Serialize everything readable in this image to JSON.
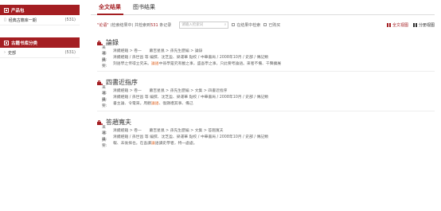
{
  "sidebar": {
    "sections": [
      {
        "header": "产品包",
        "items": [
          {
            "label": "经典古籍库一期",
            "count": "(531)"
          }
        ]
      },
      {
        "header": "古籍书库分类",
        "items": [
          {
            "label": "史部",
            "count": "(531)"
          }
        ]
      }
    ]
  },
  "main": {
    "tabs": [
      "全文结果",
      "图书结果"
    ],
    "query": "\"论语\"",
    "query_sub_prefix": "(检索结果中)",
    "query_sub_mid": " 共检索到",
    "query_count": "531",
    "query_sub_suffix": " 条记录",
    "search_placeholder": "请输入检索词",
    "checkbox1": "在结果中检索",
    "checkbox2": "已购买",
    "view_full": "全文视图",
    "view_split": "分册视图",
    "labels": {
      "source": "来　源:",
      "book": "书　目:",
      "excerpt": "摘　要:"
    },
    "results": [
      {
        "title": "論錄",
        "source": "清續經籍 > 卷一　　蕭吉星凰 > 孫先生歷編 > 論錄",
        "book": "清續經籍 / 孫世昌 等 編撰、沈芝盈、梁運華 點校 / 中華書局 / 2008年10月 / 史部 / 傳記類",
        "excerpt_pre": "刻語學之传得立究未。",
        "excerpt_hl": "論語",
        "excerpt_post": "中孫學是究有載之事，盛吾學之事，只此要考論語。來者不備、千聲擴展"
      },
      {
        "title": "四書近指序",
        "source": "清續經籍 > 卷一　　蕭吉星凰 > 孫先生歷編 > 文集 > 四書近指序",
        "book": "清續經籍 / 孫世昌 等 編撰、沈芝盈、梁運華 點校 / 中華書局 / 2008年10月 / 史部 / 傳記類",
        "excerpt_pre": "書主論、令電來。周觀",
        "excerpt_hl": "論語",
        "excerpt_post": "、復顯禮其事、備己"
      },
      {
        "title": "答趙寬夫",
        "source": "清續經籍 > 卷一　　蕭吉星凰 > 孫先生歷編 > 文集 > 答趙寬夫",
        "book": "清續經籍 / 孫世昌 等 編撰、沈芝盈、梁運華 點校 / 中華書局 / 2008年10月 / 史部 / 傳記類",
        "excerpt_pre": "報、未後探也。在吾讀",
        "excerpt_hl": "論",
        "excerpt_post": "語讀史學者，特一處處。"
      }
    ]
  },
  "colors": {
    "accent": "#a41e22",
    "highlight": "#e06a2b"
  }
}
